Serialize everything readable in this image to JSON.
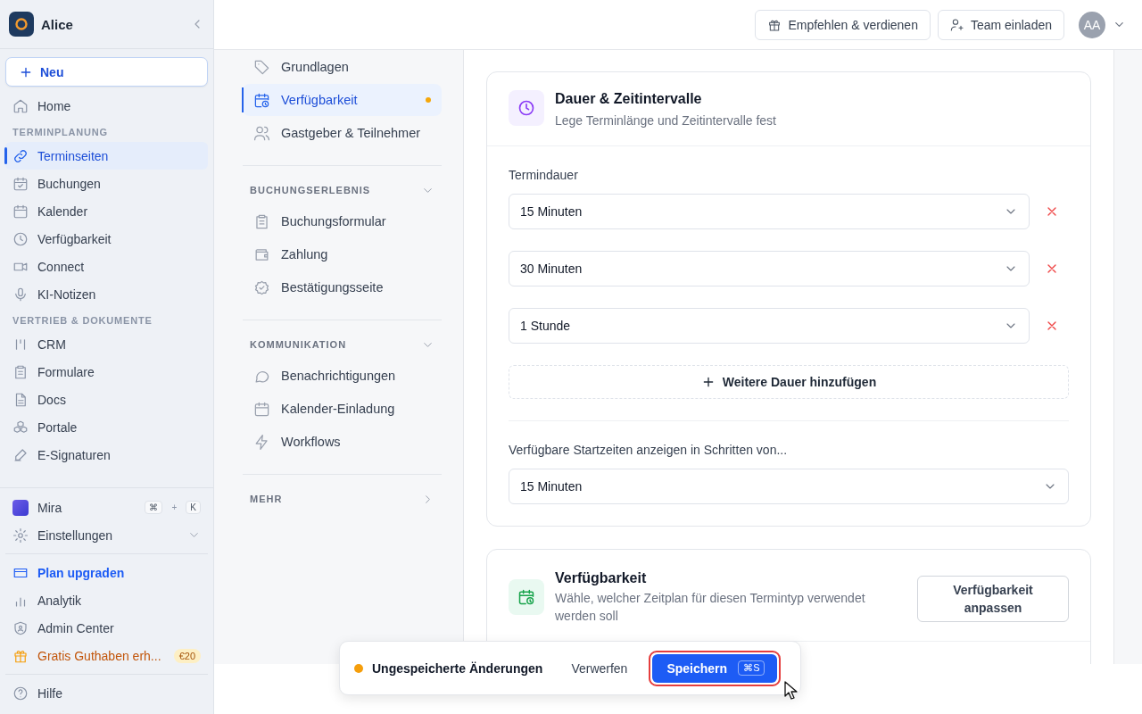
{
  "sidebar": {
    "workspace": "Alice",
    "new_button": "Neu",
    "items": [
      {
        "kind": "item",
        "label": "Home",
        "selected": false
      },
      {
        "kind": "section",
        "label": "TERMINPLANUNG"
      },
      {
        "kind": "item",
        "label": "Terminseiten",
        "selected": true
      },
      {
        "kind": "item",
        "label": "Buchungen",
        "selected": false
      },
      {
        "kind": "item",
        "label": "Kalender",
        "selected": false
      },
      {
        "kind": "item",
        "label": "Verfügbarkeit",
        "selected": false
      },
      {
        "kind": "item",
        "label": "Connect",
        "selected": false
      },
      {
        "kind": "item",
        "label": "KI-Notizen",
        "selected": false
      },
      {
        "kind": "section",
        "label": "VERTRIEB & DOKUMENTE"
      },
      {
        "kind": "item",
        "label": "CRM",
        "selected": false
      },
      {
        "kind": "item",
        "label": "Formulare",
        "selected": false
      },
      {
        "kind": "item",
        "label": "Docs",
        "selected": false
      },
      {
        "kind": "item",
        "label": "Portale",
        "selected": false
      },
      {
        "kind": "item",
        "label": "E-Signaturen",
        "selected": false
      }
    ],
    "assistant": {
      "label": "Mira",
      "shortcut_keys": [
        "⌘",
        "K"
      ],
      "shortcut_joiner": "+"
    },
    "settings": {
      "label": "Einstellungen",
      "expanded": false
    },
    "footer_items": [
      {
        "kind": "upgrade",
        "label": "Plan upgraden"
      },
      {
        "kind": "normal",
        "label": "Analytik"
      },
      {
        "kind": "normal",
        "label": "Admin Center"
      },
      {
        "kind": "promo",
        "label": "Gratis Guthaben erh...",
        "badge": "€20"
      }
    ],
    "help": "Hilfe"
  },
  "top_bar": {
    "buttons": [
      "Empfehlen & verdienen",
      "Team einladen"
    ],
    "avatar": "AA"
  },
  "subnav": {
    "groups": [
      {
        "items": [
          {
            "label": "Grundlagen",
            "selected": false,
            "unsaved": false
          },
          {
            "label": "Verfügbarkeit",
            "selected": true,
            "unsaved": true
          },
          {
            "label": "Gastgeber & Teilnehmer",
            "selected": false,
            "unsaved": false
          }
        ]
      },
      {
        "title": "BUCHUNGSERLEBNIS",
        "expanded": true,
        "items": [
          {
            "label": "Buchungsformular",
            "selected": false,
            "unsaved": false
          },
          {
            "label": "Zahlung",
            "selected": false,
            "unsaved": false
          },
          {
            "label": "Bestätigungsseite",
            "selected": false,
            "unsaved": false
          }
        ]
      },
      {
        "title": "KOMMUNIKATION",
        "expanded": true,
        "items": [
          {
            "label": "Benachrichtigungen",
            "selected": false,
            "unsaved": false
          },
          {
            "label": "Kalender-Einladung",
            "selected": false,
            "unsaved": false
          },
          {
            "label": "Workflows",
            "selected": false,
            "unsaved": false
          }
        ]
      },
      {
        "title": "MEHR",
        "expanded": false
      }
    ]
  },
  "duration_card": {
    "title": "Dauer & Zeitintervalle",
    "subtitle": "Lege Terminlänge und Zeitintervalle fest",
    "durations_label": "Termindauer",
    "durations": [
      "15 Minuten",
      "30 Minuten",
      "1 Stunde"
    ],
    "add_button": "Weitere Dauer hinzufügen",
    "interval_label": "Verfügbare Startzeiten anzeigen in Schritten von...",
    "interval_value": "15 Minuten"
  },
  "availability_card": {
    "title": "Verfügbarkeit",
    "subtitle": "Wähle, welcher Zeitplan für diesen Termintyp verwendet werden soll",
    "button": "Verfügbarkeit anpassen"
  },
  "save_bar": {
    "message": "Ungespeicherte Änderungen",
    "discard": "Verwerfen",
    "save": "Speichern",
    "save_shortcut": "⌘S",
    "save_focused": true
  }
}
